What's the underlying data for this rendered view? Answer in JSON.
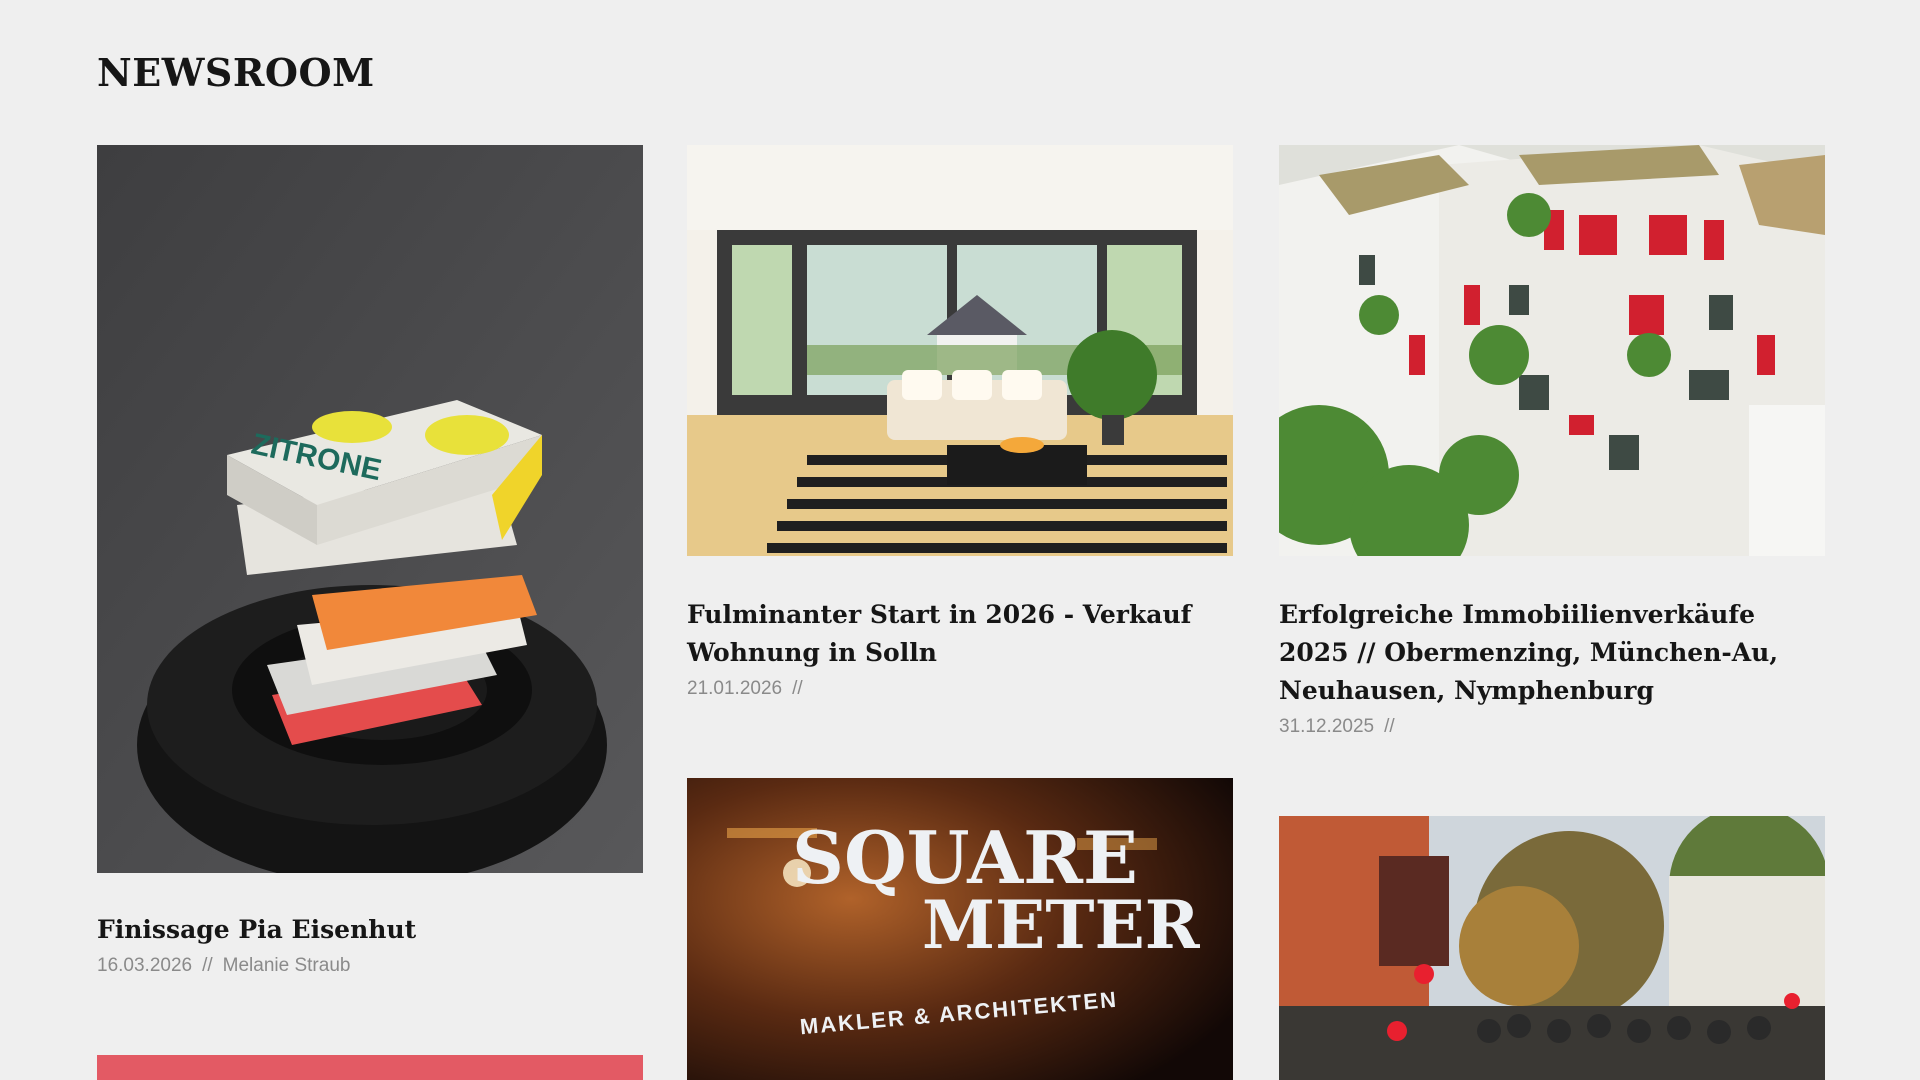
{
  "header": {
    "title": "NEWSROOM"
  },
  "articles": [
    {
      "title": "Finissage Pia Eisenhut",
      "date": "16.03.2026",
      "separator": "//",
      "author": "Melanie Straub",
      "image_text": "ZITRONE"
    },
    {
      "title": "Fulminanter Start in 2026 - Verkauf Wohnung in Solln",
      "date": "21.01.2026",
      "separator": "//",
      "author": ""
    },
    {
      "title": "Erfolgreiche Immobiilienverkäufe 2025 // Obermenzing, München-Au, Neuhausen, Nymphenburg",
      "date": "31.12.2025",
      "separator": "//",
      "author": ""
    },
    {
      "image_text_1": "SQUARE",
      "image_text_2": "METER",
      "image_text_3": "MAKLER & ARCHITEKTEN"
    },
    {},
    {}
  ],
  "colors": {
    "background": "#efefef",
    "title": "#161616",
    "meta": "#8a8a8a",
    "pink_card": "#e35a64"
  }
}
